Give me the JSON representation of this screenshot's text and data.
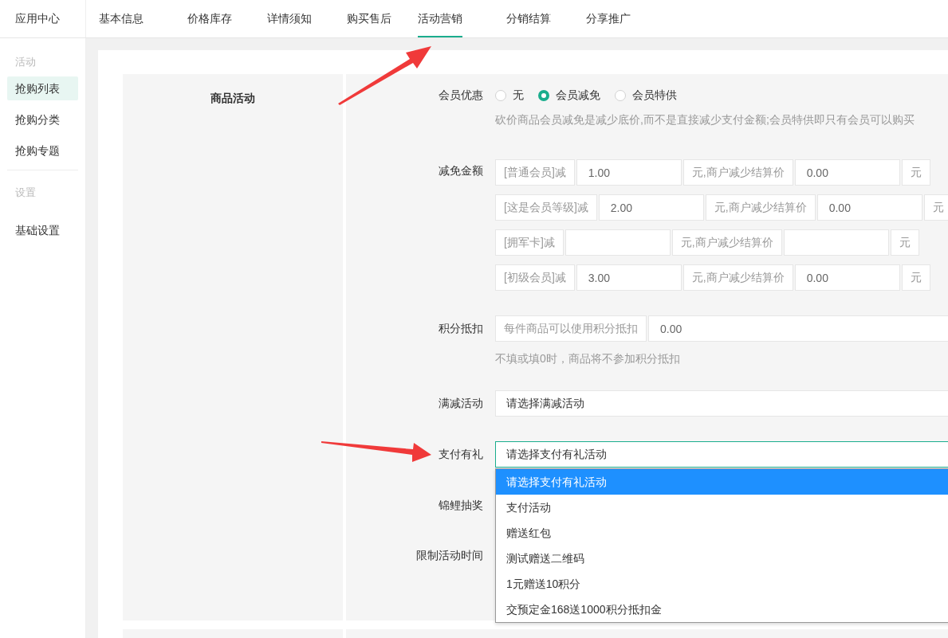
{
  "app_title": "应用中心",
  "tabs": [
    {
      "label": "基本信息",
      "selected": false
    },
    {
      "label": "价格库存",
      "selected": false
    },
    {
      "label": "详情须知",
      "selected": false
    },
    {
      "label": "购买售后",
      "selected": false
    },
    {
      "label": "活动营销",
      "selected": true
    },
    {
      "label": "分销结算",
      "selected": false
    },
    {
      "label": "分享推广",
      "selected": false
    }
  ],
  "sidebar": {
    "groups": [
      {
        "title": "活动",
        "items": [
          {
            "label": "抢购列表",
            "selected": true
          },
          {
            "label": "抢购分类",
            "selected": false
          },
          {
            "label": "抢购专题",
            "selected": false
          }
        ]
      },
      {
        "title": "设置",
        "items": [
          {
            "label": "基础设置",
            "selected": false
          }
        ]
      }
    ]
  },
  "section_title": "商品活动",
  "form": {
    "member_discount": {
      "label": "会员优惠",
      "options": [
        {
          "label": "无",
          "selected": false
        },
        {
          "label": "会员减免",
          "selected": true
        },
        {
          "label": "会员特供",
          "selected": false
        }
      ],
      "hint": "砍价商品会员减免是减少底价,而不是直接减少支付金额;会员特供即只有会员可以购买"
    },
    "reduction": {
      "label": "减免金额",
      "rows": [
        {
          "member": "[普通会员]减",
          "amount": "1.00",
          "suffix": "元,商户减少结算价",
          "settlement": "0.00",
          "unit": "元"
        },
        {
          "member": "[这是会员等级]减",
          "amount": "2.00",
          "suffix": "元,商户减少结算价",
          "settlement": "0.00",
          "unit": "元"
        },
        {
          "member": "[拥军卡]减",
          "suffix": "元,商户减少结算价",
          "unit": "元"
        },
        {
          "member": "[初级会员]减",
          "amount": "3.00",
          "suffix": "元,商户减少结算价",
          "settlement": "0.00",
          "unit": "元"
        }
      ]
    },
    "points": {
      "label": "积分抵扣",
      "prefix": "每件商品可以使用积分抵扣",
      "value": "0.00",
      "hint": "不填或填0时，商品将不参加积分抵扣"
    },
    "full_reduction": {
      "label": "满减活动",
      "value": "请选择满减活动"
    },
    "pay_gift": {
      "label": "支付有礼",
      "value": "请选择支付有礼活动",
      "expanded": true,
      "options": [
        {
          "label": "请选择支付有礼活动",
          "selected": true
        },
        {
          "label": "支付活动",
          "selected": false
        },
        {
          "label": "赠送红包",
          "selected": false
        },
        {
          "label": "测试赠送二维码",
          "selected": false
        },
        {
          "label": "1元赠送10积分",
          "selected": false
        },
        {
          "label": "交预定金168送1000积分抵扣金",
          "selected": false
        }
      ]
    },
    "lottery": {
      "label": "锦鲤抽奖"
    },
    "time_limit": {
      "label": "限制活动时间"
    }
  }
}
